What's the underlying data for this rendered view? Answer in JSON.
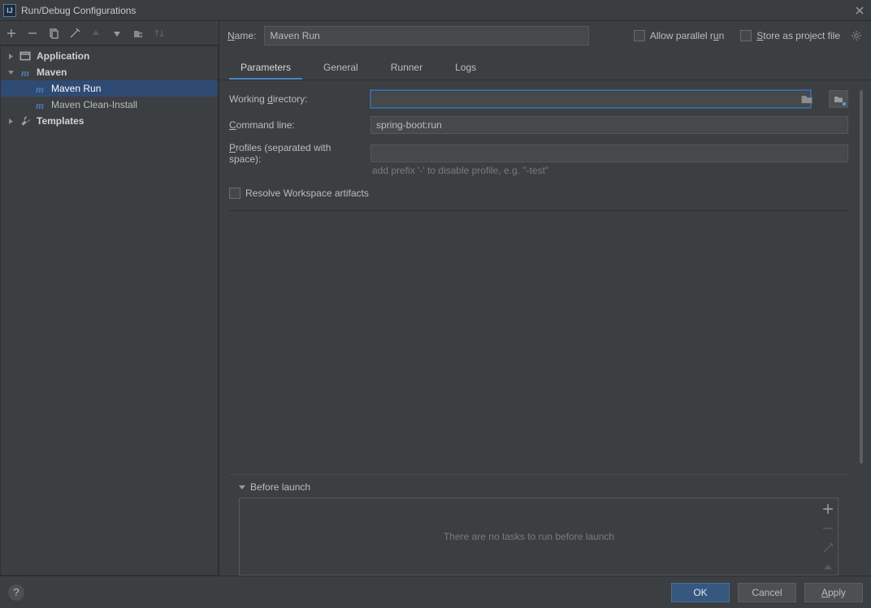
{
  "window": {
    "title": "Run/Debug Configurations"
  },
  "toolbar": {
    "add": "add",
    "remove": "remove",
    "copy": "copy",
    "wrench": "edit-defaults",
    "up": "move-up",
    "down": "move-down",
    "folder": "save",
    "sort": "sort"
  },
  "tree": {
    "items": [
      {
        "label": "Application",
        "icon": "app",
        "level": 0,
        "arrow": "right",
        "bold": true
      },
      {
        "label": "Maven",
        "icon": "m",
        "level": 0,
        "arrow": "down",
        "bold": true
      },
      {
        "label": "Maven Run",
        "icon": "m",
        "level": 1,
        "selected": true
      },
      {
        "label": "Maven Clean-Install",
        "icon": "m",
        "level": 1
      },
      {
        "label": "Templates",
        "icon": "wrench",
        "level": 0,
        "arrow": "right",
        "bold": true
      }
    ]
  },
  "header": {
    "name_label_pre": "N",
    "name_label_rest": "ame:",
    "name_value": "Maven Run",
    "allow_parallel_pre": "Allow parallel r",
    "allow_parallel_u": "u",
    "allow_parallel_post": "n",
    "store_pre": "S",
    "store_rest": "tore as project file"
  },
  "tabs": [
    {
      "label": "Parameters",
      "active": true
    },
    {
      "label": "General"
    },
    {
      "label": "Runner"
    },
    {
      "label": "Logs"
    }
  ],
  "form": {
    "wd_label_pre": "Working ",
    "wd_label_u": "d",
    "wd_label_post": "irectory:",
    "wd_value": "",
    "cmd_label_u": "C",
    "cmd_label_rest": "ommand line:",
    "cmd_value": "spring-boot:run",
    "prof_label_u": "P",
    "prof_label_rest": "rofiles (separated with space):",
    "prof_value": "",
    "prof_hint": "add prefix '-' to disable profile, e.g. \"-test\"",
    "resolve_pre": "Resolve ",
    "resolve_u": "W",
    "resolve_post": "orkspace artifacts"
  },
  "before": {
    "label_u": "B",
    "label_rest": "efore launch",
    "empty": "There are no tasks to run before launch"
  },
  "footer": {
    "ok": "OK",
    "cancel": "Cancel",
    "apply_u": "A",
    "apply_rest": "pply"
  }
}
